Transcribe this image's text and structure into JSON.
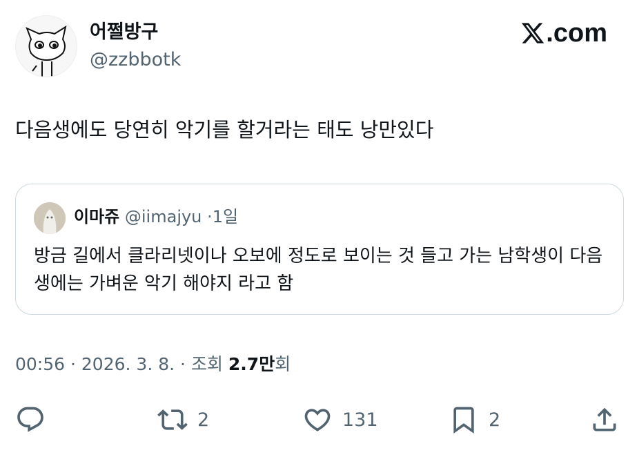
{
  "author": {
    "display_name": "어쩔방구",
    "handle": "@zzbbotk",
    "avatar_icon": "cat-doodle-avatar-icon"
  },
  "brand": {
    "icon": "x-logo-icon",
    "text": ".com"
  },
  "tweet": {
    "text": "다음생에도 당연히 악기를 할거라는 태도 낭만있다"
  },
  "quoted_tweet": {
    "display_name": "이마쥬",
    "handle": "@iimajyu",
    "separator": "·",
    "time": "1일",
    "text": "방금 길에서 클라리넷이나 오보에 정도로 보이는 것 들고 가는 남학생이 다음 생에는 가벼운 악기 해야지 라고 함",
    "avatar_icon": "ghost-photo-avatar-icon"
  },
  "meta": {
    "time": "00:56",
    "separator": "·",
    "date": "2026. 3. 8.",
    "views_label": "조회",
    "views_count": "2.7만",
    "views_unit": "회"
  },
  "actions": {
    "reply": {
      "icon": "reply-icon",
      "count": ""
    },
    "retweet": {
      "icon": "retweet-icon",
      "count": "2"
    },
    "like": {
      "icon": "heart-icon",
      "count": "131"
    },
    "bookmark": {
      "icon": "bookmark-icon",
      "count": "2"
    },
    "share": {
      "icon": "share-icon",
      "count": ""
    }
  },
  "colors": {
    "text_primary": "#0f1419",
    "text_secondary": "#536471",
    "border": "#cfd9de"
  }
}
